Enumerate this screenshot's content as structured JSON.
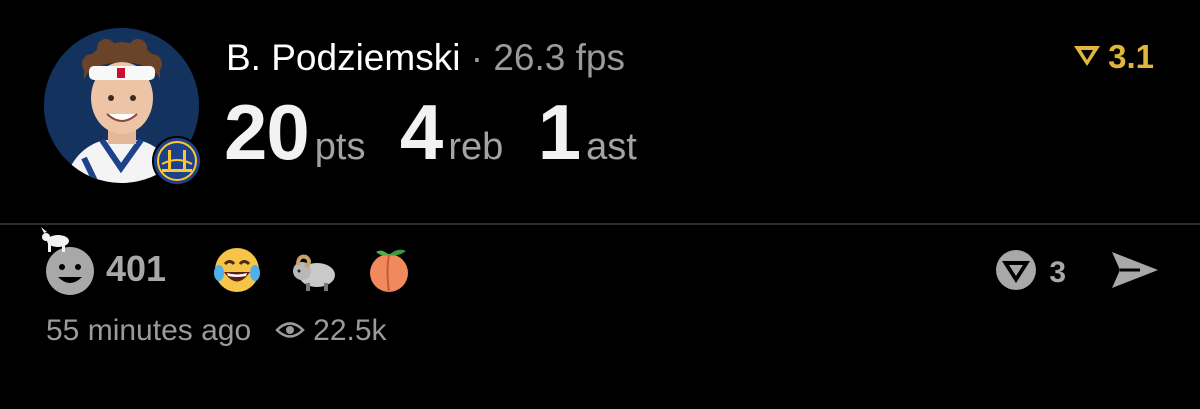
{
  "player": {
    "name": "B. Podziemski",
    "separator": "·",
    "fps": "26.3 fps"
  },
  "stats": [
    {
      "value": "20",
      "unit": "pts"
    },
    {
      "value": "4",
      "unit": "reb"
    },
    {
      "value": "1",
      "unit": "ast"
    }
  ],
  "rating": {
    "value": "3.1",
    "color": "#e2b53b"
  },
  "reactions": {
    "count": "401",
    "icons": [
      "goat-smiley-icon",
      "laughing-emoji-icon",
      "ram-emoji-icon",
      "peach-emoji-icon"
    ]
  },
  "comments": {
    "count": "3"
  },
  "meta": {
    "time_ago": "55 minutes ago",
    "views": "22.5k"
  }
}
